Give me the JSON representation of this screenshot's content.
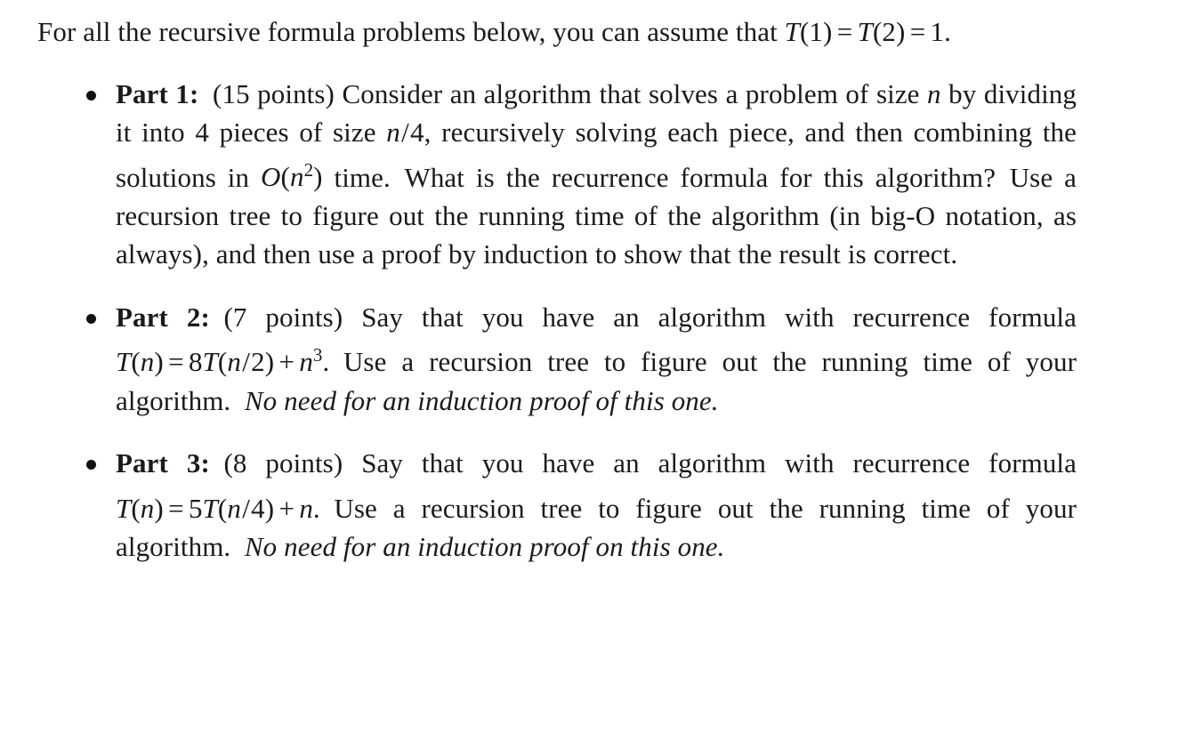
{
  "document": {
    "intro": {
      "text_before_math": "For all the recursive formula problems below, you can assume that ",
      "math": {
        "t_symbol": "T",
        "open_paren": "(",
        "arg_one": "1",
        "close_paren": ")",
        "equals": "=",
        "t_symbol_2": "T",
        "arg_two": "2",
        "equals_2": "=",
        "value": "1",
        "period": "."
      }
    },
    "parts": [
      {
        "label": "Part 1:",
        "points": "(15 points)",
        "text_1": "Consider an algorithm that solves a problem of size ",
        "var_n": "n",
        "text_2": " by dividing it into 4 pieces of size ",
        "math_frac": {
          "num": "n",
          "slash": "/",
          "den": "4"
        },
        "text_3": ", recursively solving each piece, and then combining the solutions in ",
        "math_big_o": {
          "o": "O",
          "open": "(",
          "var": "n",
          "exp": "2",
          "close": ")"
        },
        "text_4": " time.",
        "text_5": "What is the recurrence formula for this algorithm?",
        "text_6": "Use a recursion tree to figure out the running time of the algorithm (in big-O notation, as always), and then use a proof by induction to show that the result is correct."
      },
      {
        "label": "Part 2:",
        "points": "(7 points)",
        "text_1": "Say that you have an algorithm with recurrence formula ",
        "recurrence": {
          "t": "T",
          "open": "(",
          "var": "n",
          "close": ")",
          "equals": "=",
          "coef": "8",
          "t2": "T",
          "open2": "(",
          "num": "n",
          "slash": "/",
          "den": "2",
          "close2": ")",
          "plus": "+",
          "term_var": "n",
          "term_exp": "3",
          "period": "."
        },
        "text_2": "Use a recursion tree to figure out the running time of your algorithm.",
        "emphasis": "No need for an induction proof of this one."
      },
      {
        "label": "Part 3:",
        "points": "(8 points)",
        "text_1": "Say that you have an algorithm with recurrence formula ",
        "recurrence": {
          "t": "T",
          "open": "(",
          "var": "n",
          "close": ")",
          "equals": "=",
          "coef": "5",
          "t2": "T",
          "open2": "(",
          "num": "n",
          "slash": "/",
          "den": "4",
          "close2": ")",
          "plus": "+",
          "term_var": "n",
          "term_exp": "",
          "period": "."
        },
        "text_2": "Use a recursion tree to figure out the running time of your algorithm.",
        "emphasis": "No need for an induction proof on this one."
      }
    ]
  }
}
